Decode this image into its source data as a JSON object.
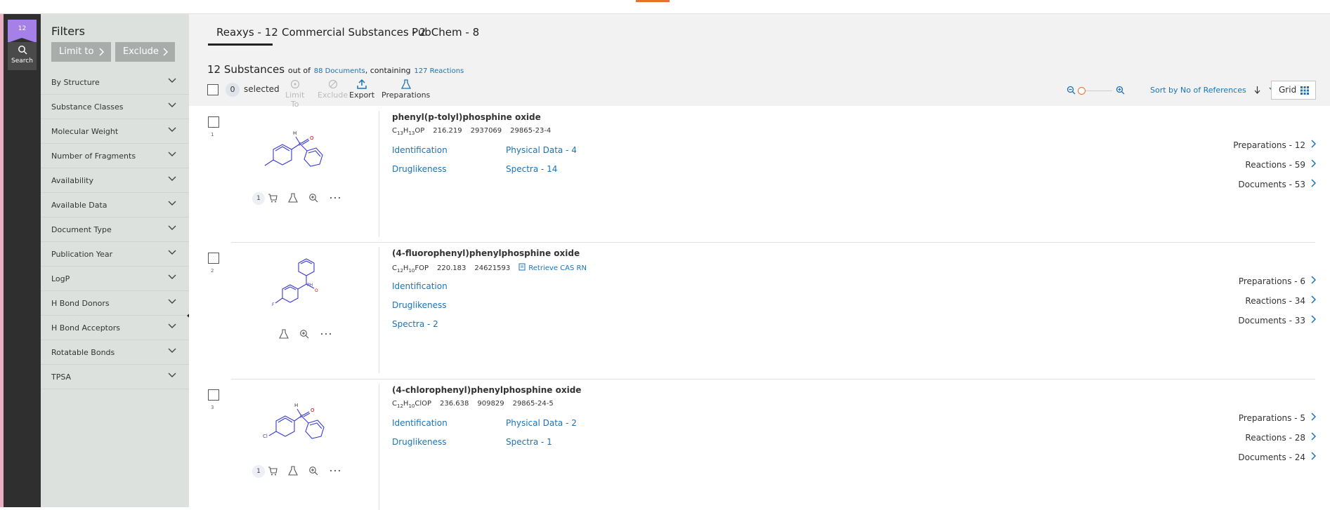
{
  "rail": {
    "badge_count": "12",
    "search_label": "Search"
  },
  "filters": {
    "title": "Filters",
    "limit_to": "Limit to",
    "exclude": "Exclude",
    "items": [
      "By Structure",
      "Substance Classes",
      "Molecular Weight",
      "Number of Fragments",
      "Availability",
      "Available Data",
      "Document Type",
      "Publication Year",
      "LogP",
      "H Bond Donors",
      "H Bond Acceptors",
      "Rotatable Bonds",
      "TPSA"
    ]
  },
  "tabs": [
    "Reaxys - 12",
    "Commercial Substances - 2",
    "PubChem - 8"
  ],
  "summary": {
    "count": "12 Substances",
    "out_of": "out of",
    "documents_link": "88 Documents",
    "containing": ", containing",
    "reactions_link": "127 Reactions"
  },
  "selection": {
    "count": "0",
    "label": "selected"
  },
  "toolbar": {
    "limit_to": "Limit To",
    "exclude": "Exclude",
    "export": "Export",
    "preparations": "Preparations"
  },
  "sort": {
    "label": "Sort by No of References"
  },
  "view": {
    "grid_label": "Grid"
  },
  "colors": {
    "accent_purple": "#a580e8",
    "accent_orange": "#e8722c",
    "link_blue": "#1a73b8",
    "structure_blue": "#3a3ad8"
  },
  "results": [
    {
      "index": "1",
      "name": "phenyl(p-tolyl)phosphine oxide",
      "formula": {
        "c": "13",
        "h": "13",
        "rest": "OP"
      },
      "mw": "216.219",
      "reaxys_id": "2937069",
      "cas": "29865-23-4",
      "supplier_count": "1",
      "links_left": [
        "Identification",
        "Druglikeness"
      ],
      "links_right": [
        "Physical Data - 4",
        "Spectra - 14"
      ],
      "counts": [
        "Preparations - 12",
        "Reactions - 59",
        "Documents - 53"
      ]
    },
    {
      "index": "2",
      "name": "(4-fluorophenyl)phenylphosphine oxide",
      "formula": {
        "c": "12",
        "h": "10",
        "rest": "FOP"
      },
      "mw": "220.183",
      "reaxys_id": "24621593",
      "retrieve_cas": "Retrieve CAS RN",
      "links_left": [
        "Identification",
        "Druglikeness",
        "Spectra - 2"
      ],
      "counts": [
        "Preparations - 6",
        "Reactions - 34",
        "Documents - 33"
      ]
    },
    {
      "index": "3",
      "name": "(4-chlorophenyl)phenylphosphine oxide",
      "formula": {
        "c": "12",
        "h": "10",
        "rest": "ClOP"
      },
      "mw": "236.638",
      "reaxys_id": "909829",
      "cas": "29865-24-5",
      "supplier_count": "1",
      "links_left": [
        "Identification",
        "Druglikeness"
      ],
      "links_right": [
        "Physical Data - 2",
        "Spectra - 1"
      ],
      "counts": [
        "Preparations - 5",
        "Reactions - 28",
        "Documents - 24"
      ]
    }
  ]
}
